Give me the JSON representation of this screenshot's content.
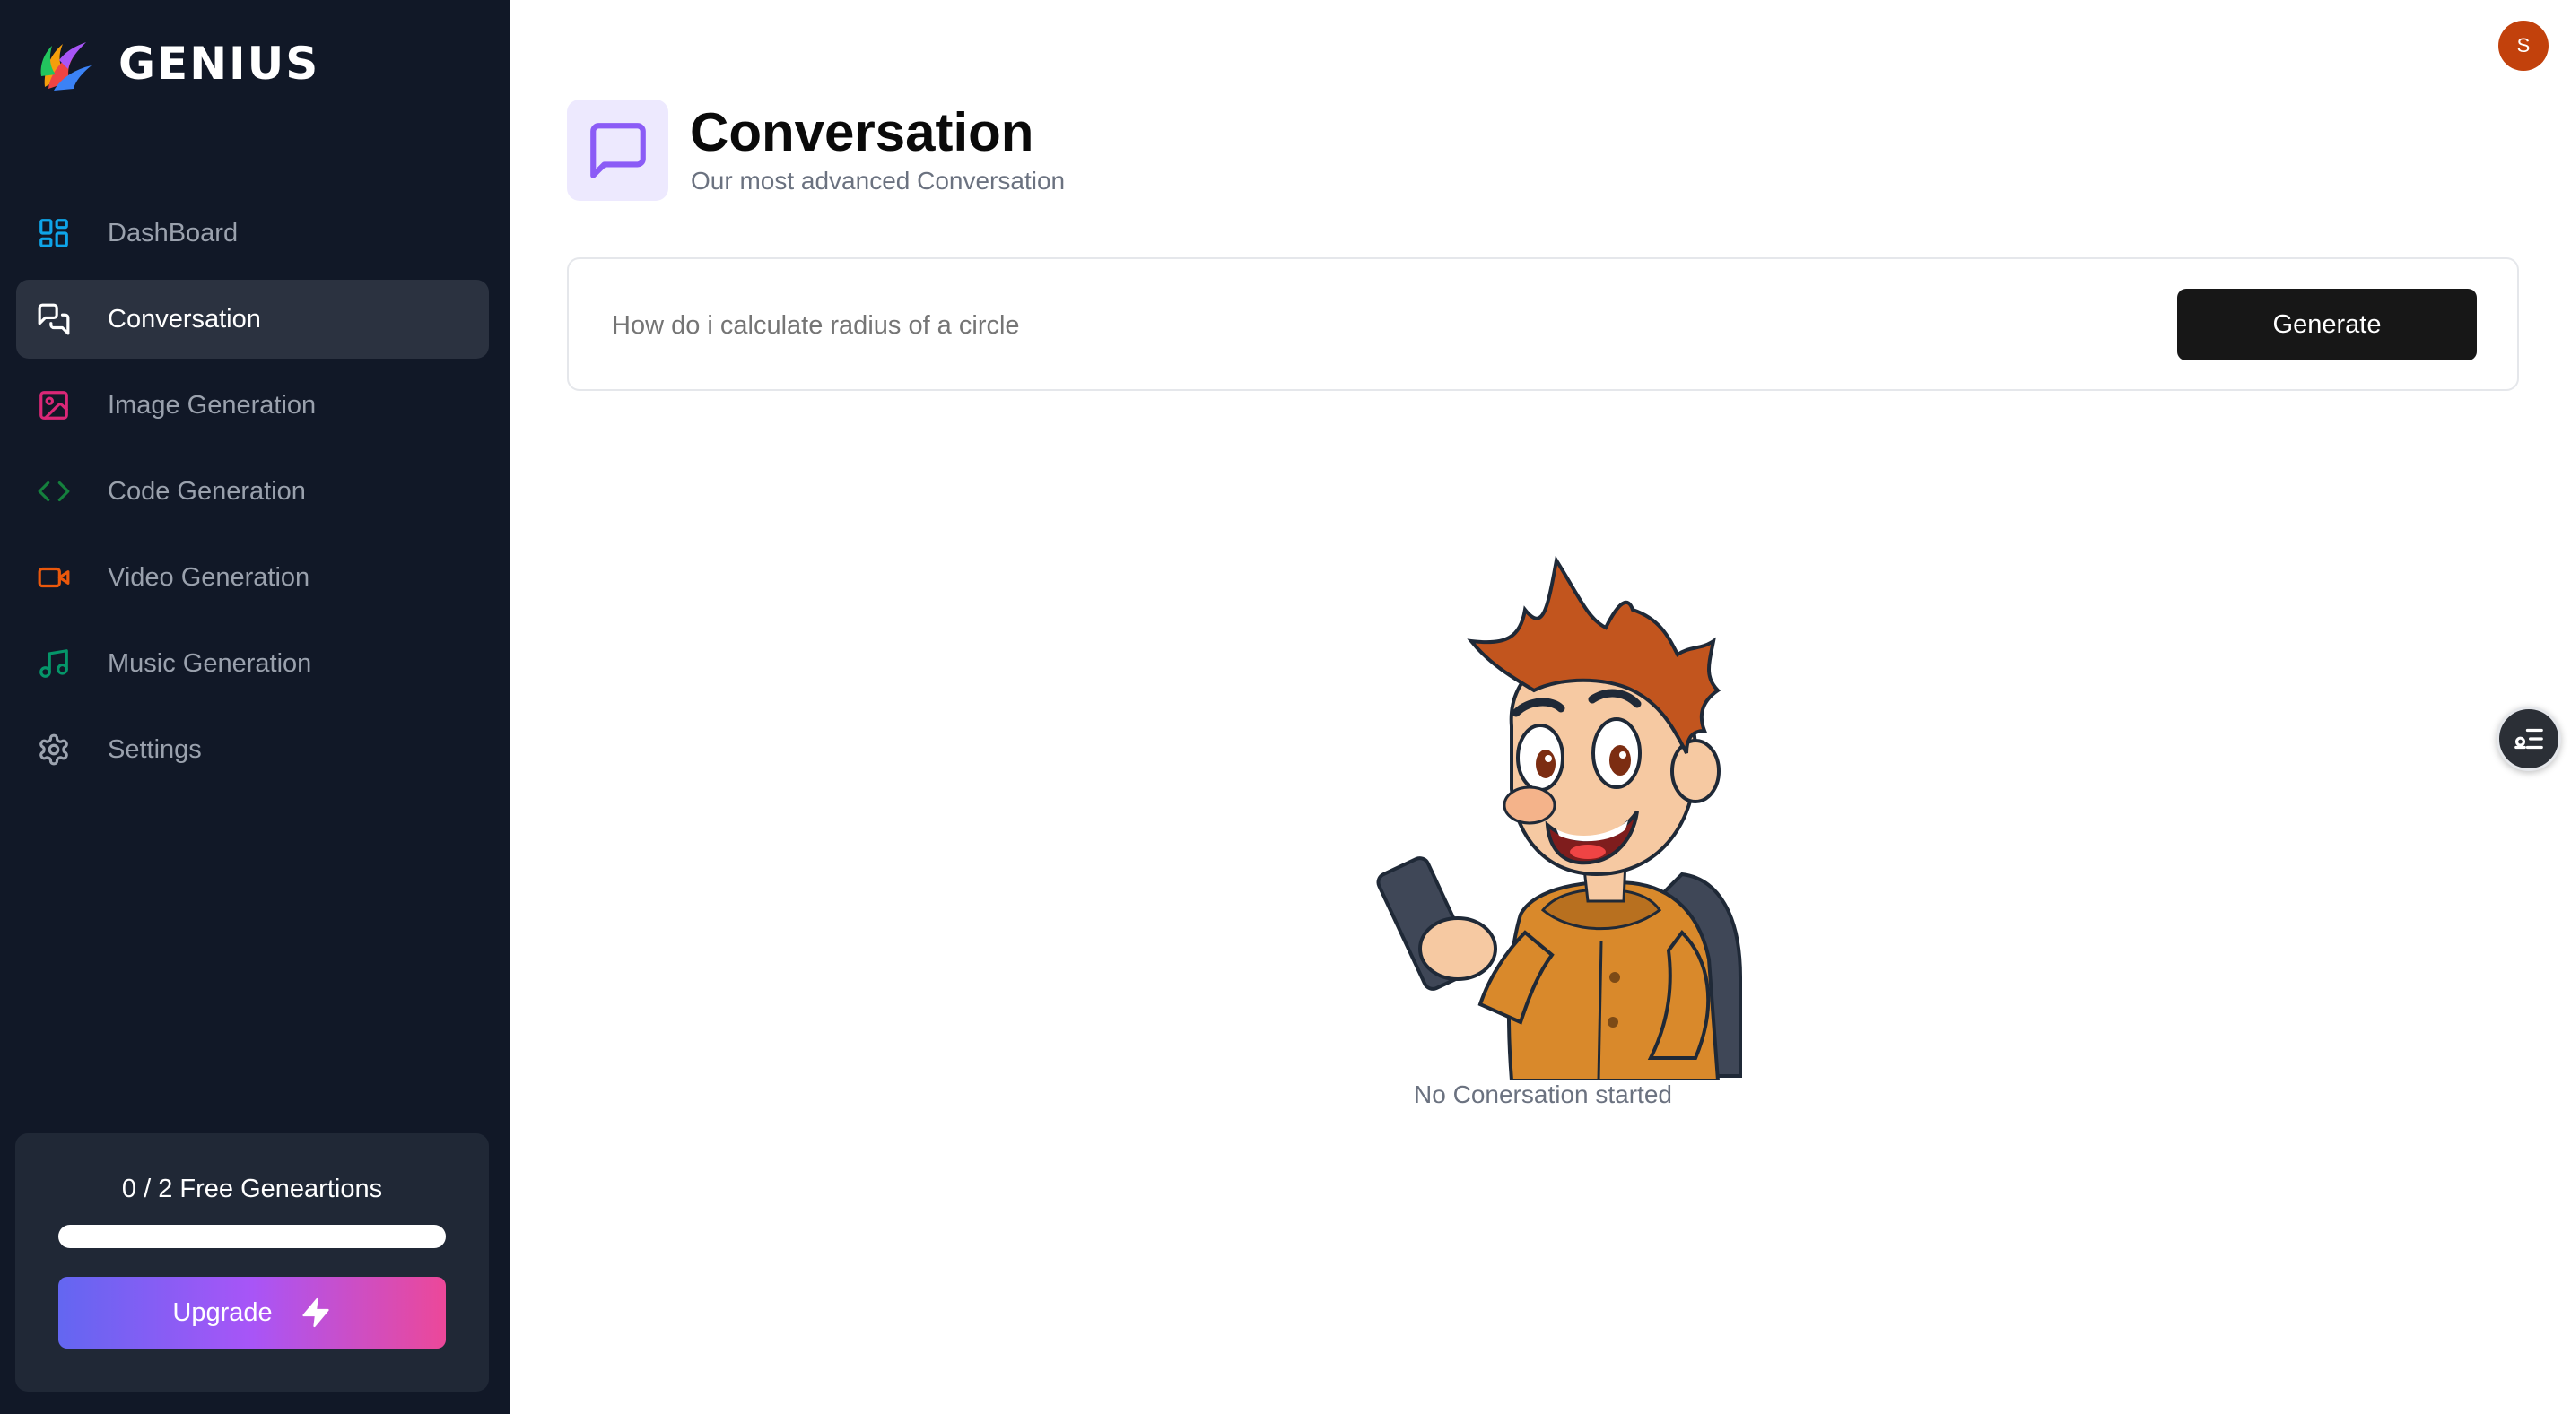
{
  "brand": {
    "name": "GENIUS",
    "logo_icon": "flame-logo-icon"
  },
  "sidebar": {
    "items": [
      {
        "label": "DashBoard",
        "icon": "layout-dashboard-icon",
        "color": "#0ea5e9",
        "active": false
      },
      {
        "label": "Conversation",
        "icon": "messages-icon",
        "color": "#ffffff",
        "active": true
      },
      {
        "label": "Image Generation",
        "icon": "image-icon",
        "color": "#db2777",
        "active": false
      },
      {
        "label": "Code Generation",
        "icon": "code-icon",
        "color": "#15803d",
        "active": false
      },
      {
        "label": "Video Generation",
        "icon": "video-icon",
        "color": "#ea580c",
        "active": false
      },
      {
        "label": "Music Generation",
        "icon": "music-icon",
        "color": "#059669",
        "active": false
      },
      {
        "label": "Settings",
        "icon": "settings-icon",
        "color": "#9ca3af",
        "active": false
      }
    ],
    "credits": {
      "text": "0 / 2 Free Geneartions",
      "used": 0,
      "limit": 2,
      "progress_fraction": 0,
      "upgrade_label": "Upgrade",
      "upgrade_icon": "zap-icon"
    }
  },
  "user": {
    "avatar_initial": "S",
    "avatar_color": "#c2410c"
  },
  "header": {
    "title": "Conversation",
    "subtitle": "Our most advanced Conversation",
    "icon": "message-square-icon",
    "icon_color": "#8b5cf6",
    "icon_bg": "#ede9fe"
  },
  "prompt": {
    "value": "",
    "placeholder": "How do i calculate radius of a circle",
    "generate_label": "Generate"
  },
  "empty_state": {
    "text": "No Conersation started",
    "illustration": "cartoon-boy-with-phone"
  },
  "floating_button": {
    "icon": "list-toggle-icon"
  }
}
